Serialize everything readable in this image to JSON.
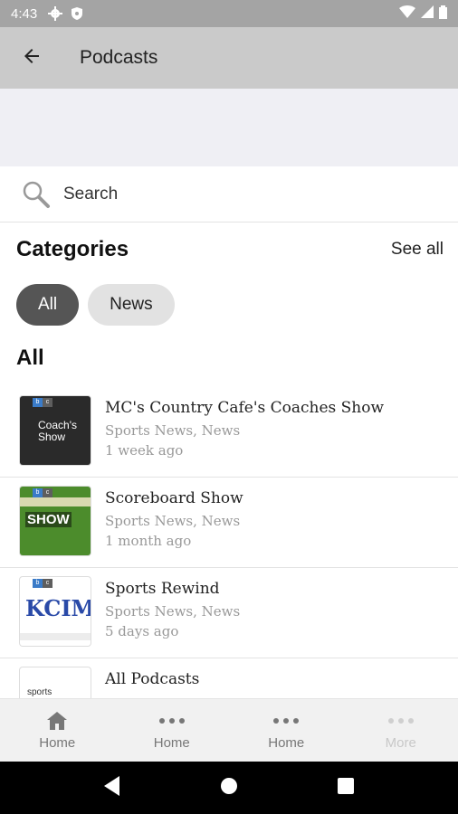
{
  "status_bar": {
    "time": "4:43"
  },
  "app_bar": {
    "title": "Podcasts"
  },
  "search": {
    "label": "Search"
  },
  "categories": {
    "heading": "Categories",
    "see_all": "See all",
    "chips": [
      {
        "label": "All",
        "active": true
      },
      {
        "label": "News",
        "active": false
      }
    ]
  },
  "all_section": {
    "heading": "All"
  },
  "podcasts": [
    {
      "title": "MC's Country Cafe's Coaches Show",
      "categories": "Sports News, News",
      "date": "1 week ago",
      "thumb_text": "Coach's Show",
      "badge": [
        "b",
        "c"
      ]
    },
    {
      "title": "Scoreboard Show",
      "categories": "Sports News, News",
      "date": "1 month ago",
      "thumb_text": "SHOW",
      "badge": [
        "b",
        "c"
      ]
    },
    {
      "title": "Sports Rewind",
      "categories": "Sports News, News",
      "date": "5 days ago",
      "thumb_text": "KCIM",
      "badge": [
        "b",
        "c"
      ]
    },
    {
      "title": "All Podcasts",
      "categories": "",
      "date": "",
      "thumb_text": "sports",
      "badge": []
    }
  ],
  "bottom_nav": [
    {
      "label": "Home",
      "icon": "home-icon",
      "disabled": false
    },
    {
      "label": "Home",
      "icon": "more-dots-icon",
      "disabled": false
    },
    {
      "label": "Home",
      "icon": "more-dots-icon",
      "disabled": false
    },
    {
      "label": "More",
      "icon": "more-dots-icon",
      "disabled": true
    }
  ],
  "colors": {
    "status_bar": "#a4a4a4",
    "app_bar": "#cacaca",
    "banner": "#efeff4",
    "chip_active": "#555555",
    "chip_inactive": "#e2e2e2",
    "bottom_nav": "#f1f1f1"
  }
}
